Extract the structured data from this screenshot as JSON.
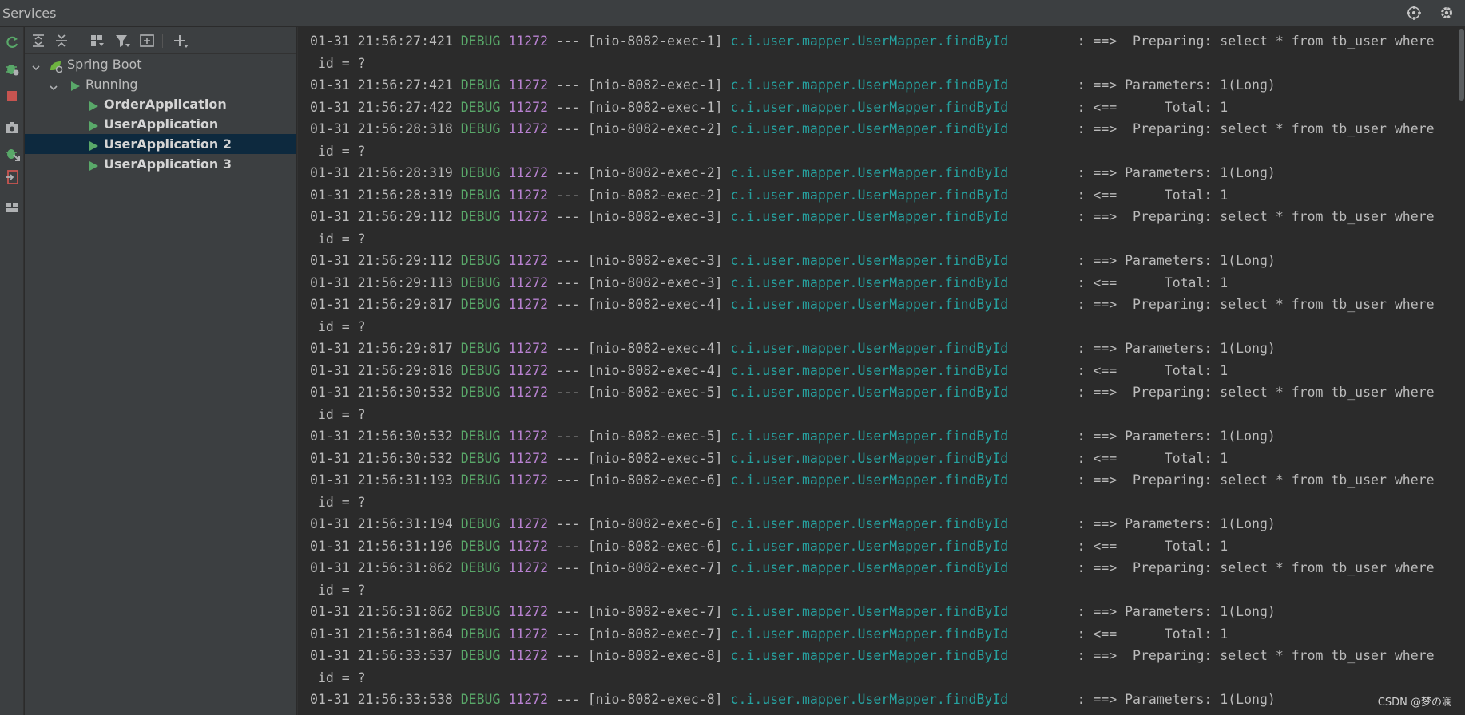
{
  "window": {
    "title": "Services"
  },
  "titlebar_icons": [
    "target-icon",
    "gear-icon"
  ],
  "tree": {
    "root": {
      "label": "Spring Boot",
      "expanded": true
    },
    "group": {
      "label": "Running",
      "expanded": true
    },
    "apps": [
      {
        "label": "OrderApplication",
        "selected": false
      },
      {
        "label": "UserApplication",
        "selected": false
      },
      {
        "label": "UserApplication 2",
        "selected": true
      },
      {
        "label": "UserApplication 3",
        "selected": false
      }
    ]
  },
  "colors": {
    "debug": "#59a869",
    "pid": "#b882d1",
    "logger": "#26a2a0",
    "selection": "#0d293e"
  },
  "console": {
    "lines": [
      {
        "ts": "01-31 21:56:27:421",
        "level": "DEBUG",
        "pid": "11272",
        "sep": "---",
        "thread": "[nio-8082-exec-1]",
        "logger": "c.i.user.mapper.UserMapper.findById",
        "msg": ": ==>  Preparing: select * from tb_user where"
      },
      {
        "cont": " id = ?"
      },
      {
        "ts": "01-31 21:56:27:421",
        "level": "DEBUG",
        "pid": "11272",
        "sep": "---",
        "thread": "[nio-8082-exec-1]",
        "logger": "c.i.user.mapper.UserMapper.findById",
        "msg": ": ==> Parameters: 1(Long)"
      },
      {
        "ts": "01-31 21:56:27:422",
        "level": "DEBUG",
        "pid": "11272",
        "sep": "---",
        "thread": "[nio-8082-exec-1]",
        "logger": "c.i.user.mapper.UserMapper.findById",
        "msg": ": <==      Total: 1"
      },
      {
        "ts": "01-31 21:56:28:318",
        "level": "DEBUG",
        "pid": "11272",
        "sep": "---",
        "thread": "[nio-8082-exec-2]",
        "logger": "c.i.user.mapper.UserMapper.findById",
        "msg": ": ==>  Preparing: select * from tb_user where"
      },
      {
        "cont": " id = ?"
      },
      {
        "ts": "01-31 21:56:28:319",
        "level": "DEBUG",
        "pid": "11272",
        "sep": "---",
        "thread": "[nio-8082-exec-2]",
        "logger": "c.i.user.mapper.UserMapper.findById",
        "msg": ": ==> Parameters: 1(Long)"
      },
      {
        "ts": "01-31 21:56:28:319",
        "level": "DEBUG",
        "pid": "11272",
        "sep": "---",
        "thread": "[nio-8082-exec-2]",
        "logger": "c.i.user.mapper.UserMapper.findById",
        "msg": ": <==      Total: 1"
      },
      {
        "ts": "01-31 21:56:29:112",
        "level": "DEBUG",
        "pid": "11272",
        "sep": "---",
        "thread": "[nio-8082-exec-3]",
        "logger": "c.i.user.mapper.UserMapper.findById",
        "msg": ": ==>  Preparing: select * from tb_user where"
      },
      {
        "cont": " id = ?"
      },
      {
        "ts": "01-31 21:56:29:112",
        "level": "DEBUG",
        "pid": "11272",
        "sep": "---",
        "thread": "[nio-8082-exec-3]",
        "logger": "c.i.user.mapper.UserMapper.findById",
        "msg": ": ==> Parameters: 1(Long)"
      },
      {
        "ts": "01-31 21:56:29:113",
        "level": "DEBUG",
        "pid": "11272",
        "sep": "---",
        "thread": "[nio-8082-exec-3]",
        "logger": "c.i.user.mapper.UserMapper.findById",
        "msg": ": <==      Total: 1"
      },
      {
        "ts": "01-31 21:56:29:817",
        "level": "DEBUG",
        "pid": "11272",
        "sep": "---",
        "thread": "[nio-8082-exec-4]",
        "logger": "c.i.user.mapper.UserMapper.findById",
        "msg": ": ==>  Preparing: select * from tb_user where"
      },
      {
        "cont": " id = ?"
      },
      {
        "ts": "01-31 21:56:29:817",
        "level": "DEBUG",
        "pid": "11272",
        "sep": "---",
        "thread": "[nio-8082-exec-4]",
        "logger": "c.i.user.mapper.UserMapper.findById",
        "msg": ": ==> Parameters: 1(Long)"
      },
      {
        "ts": "01-31 21:56:29:818",
        "level": "DEBUG",
        "pid": "11272",
        "sep": "---",
        "thread": "[nio-8082-exec-4]",
        "logger": "c.i.user.mapper.UserMapper.findById",
        "msg": ": <==      Total: 1"
      },
      {
        "ts": "01-31 21:56:30:532",
        "level": "DEBUG",
        "pid": "11272",
        "sep": "---",
        "thread": "[nio-8082-exec-5]",
        "logger": "c.i.user.mapper.UserMapper.findById",
        "msg": ": ==>  Preparing: select * from tb_user where"
      },
      {
        "cont": " id = ?"
      },
      {
        "ts": "01-31 21:56:30:532",
        "level": "DEBUG",
        "pid": "11272",
        "sep": "---",
        "thread": "[nio-8082-exec-5]",
        "logger": "c.i.user.mapper.UserMapper.findById",
        "msg": ": ==> Parameters: 1(Long)"
      },
      {
        "ts": "01-31 21:56:30:532",
        "level": "DEBUG",
        "pid": "11272",
        "sep": "---",
        "thread": "[nio-8082-exec-5]",
        "logger": "c.i.user.mapper.UserMapper.findById",
        "msg": ": <==      Total: 1"
      },
      {
        "ts": "01-31 21:56:31:193",
        "level": "DEBUG",
        "pid": "11272",
        "sep": "---",
        "thread": "[nio-8082-exec-6]",
        "logger": "c.i.user.mapper.UserMapper.findById",
        "msg": ": ==>  Preparing: select * from tb_user where"
      },
      {
        "cont": " id = ?"
      },
      {
        "ts": "01-31 21:56:31:194",
        "level": "DEBUG",
        "pid": "11272",
        "sep": "---",
        "thread": "[nio-8082-exec-6]",
        "logger": "c.i.user.mapper.UserMapper.findById",
        "msg": ": ==> Parameters: 1(Long)"
      },
      {
        "ts": "01-31 21:56:31:196",
        "level": "DEBUG",
        "pid": "11272",
        "sep": "---",
        "thread": "[nio-8082-exec-6]",
        "logger": "c.i.user.mapper.UserMapper.findById",
        "msg": ": <==      Total: 1"
      },
      {
        "ts": "01-31 21:56:31:862",
        "level": "DEBUG",
        "pid": "11272",
        "sep": "---",
        "thread": "[nio-8082-exec-7]",
        "logger": "c.i.user.mapper.UserMapper.findById",
        "msg": ": ==>  Preparing: select * from tb_user where"
      },
      {
        "cont": " id = ?"
      },
      {
        "ts": "01-31 21:56:31:862",
        "level": "DEBUG",
        "pid": "11272",
        "sep": "---",
        "thread": "[nio-8082-exec-7]",
        "logger": "c.i.user.mapper.UserMapper.findById",
        "msg": ": ==> Parameters: 1(Long)"
      },
      {
        "ts": "01-31 21:56:31:864",
        "level": "DEBUG",
        "pid": "11272",
        "sep": "---",
        "thread": "[nio-8082-exec-7]",
        "logger": "c.i.user.mapper.UserMapper.findById",
        "msg": ": <==      Total: 1"
      },
      {
        "ts": "01-31 21:56:33:537",
        "level": "DEBUG",
        "pid": "11272",
        "sep": "---",
        "thread": "[nio-8082-exec-8]",
        "logger": "c.i.user.mapper.UserMapper.findById",
        "msg": ": ==>  Preparing: select * from tb_user where"
      },
      {
        "cont": " id = ?"
      },
      {
        "ts": "01-31 21:56:33:538",
        "level": "DEBUG",
        "pid": "11272",
        "sep": "---",
        "thread": "[nio-8082-exec-8]",
        "logger": "c.i.user.mapper.UserMapper.findById",
        "msg": ": ==> Parameters: 1(Long)"
      }
    ]
  },
  "watermark": "CSDN @梦の澜"
}
